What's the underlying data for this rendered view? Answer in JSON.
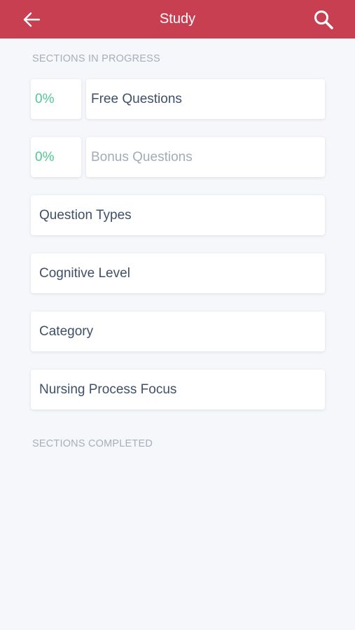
{
  "header": {
    "title": "Study",
    "back_icon": "arrow-left-icon",
    "search_icon": "search-icon",
    "bg_color": "#c93f52"
  },
  "sections_in_progress": {
    "title": "SECTIONS IN PROGRESS",
    "items": [
      {
        "percent": "0%",
        "label": "Free Questions",
        "state": "active"
      },
      {
        "percent": "0%",
        "label": "Bonus Questions",
        "state": "muted"
      }
    ],
    "groups": [
      {
        "label": "Question Types"
      },
      {
        "label": "Cognitive Level"
      },
      {
        "label": "Category"
      },
      {
        "label": "Nursing Process Focus"
      }
    ]
  },
  "sections_completed": {
    "title": "SECTIONS COMPLETED"
  },
  "colors": {
    "percent": "#4fc894",
    "text": "#3e5068",
    "muted": "#a3abb6"
  }
}
